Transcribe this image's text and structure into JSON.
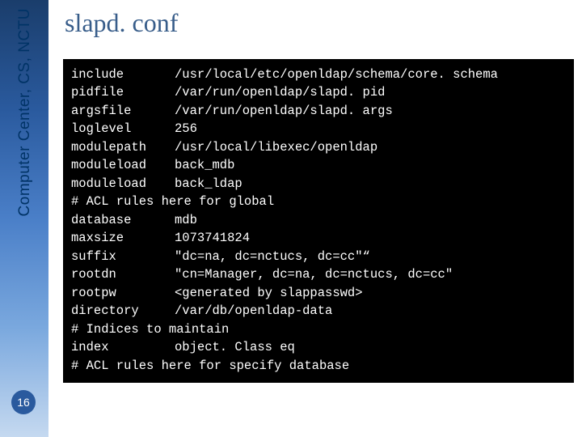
{
  "sidebar_label": "Computer Center, CS, NCTU",
  "page_number": "16",
  "title": "slapd. conf",
  "config": {
    "rows": [
      {
        "k": "include",
        "v": "/usr/local/etc/openldap/schema/core. schema"
      },
      {
        "k": "pidfile",
        "v": "/var/run/openldap/slapd. pid"
      },
      {
        "k": "argsfile",
        "v": "/var/run/openldap/slapd. args"
      },
      {
        "k": "loglevel",
        "v": "256"
      },
      {
        "k": "modulepath",
        "v": "/usr/local/libexec/openldap"
      },
      {
        "k": "moduleload",
        "v": "back_mdb"
      },
      {
        "k": "moduleload",
        "v": "back_ldap"
      }
    ],
    "comment1": "# ACL rules here for global",
    "rows2": [
      {
        "k": "database",
        "v": "mdb"
      },
      {
        "k": "maxsize",
        "v": "1073741824"
      },
      {
        "k": "suffix",
        "v": "\"dc=na, dc=nctucs, dc=cc\"“"
      },
      {
        "k": "rootdn",
        "v": "\"cn=Manager, dc=na, dc=nctucs, dc=cc\""
      },
      {
        "k": "rootpw",
        "v": "<generated by slappasswd>"
      },
      {
        "k": "directory",
        "v": "/var/db/openldap-data"
      }
    ],
    "blank": "",
    "comment2": "# Indices to maintain",
    "rows3": [
      {
        "k": "index",
        "v": "object. Class eq"
      }
    ],
    "comment3": "# ACL rules here for specify database"
  }
}
